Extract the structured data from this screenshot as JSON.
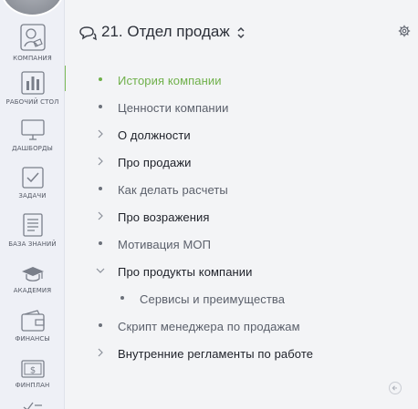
{
  "sidebar": {
    "items": [
      {
        "label": "КОМПАНИЯ",
        "icon": "company-icon"
      },
      {
        "label": "РАБОЧИЙ СТОЛ",
        "icon": "bar-chart-icon"
      },
      {
        "label": "ДАШБОРДЫ",
        "icon": "monitor-icon"
      },
      {
        "label": "ЗАДАЧИ",
        "icon": "checkbox-icon"
      },
      {
        "label": "БАЗА ЗНАНИЙ",
        "icon": "document-icon"
      },
      {
        "label": "АКАДЕМИЯ",
        "icon": "graduation-cap-icon"
      },
      {
        "label": "ФИНАНСЫ",
        "icon": "wallet-icon"
      },
      {
        "label": "ФИНПЛАН",
        "icon": "dollar-bill-icon"
      }
    ]
  },
  "header": {
    "title": "21. Отдел продаж",
    "title_icon": "chat-bubbles-icon",
    "settings_icon": "gear-icon"
  },
  "tree": {
    "items": [
      {
        "label": "История компании",
        "type": "leaf",
        "level": 0,
        "active": true
      },
      {
        "label": "Ценности компании",
        "type": "leaf",
        "level": 0
      },
      {
        "label": "О должности",
        "type": "folder",
        "level": 0,
        "expanded": false
      },
      {
        "label": "Про продажи",
        "type": "folder",
        "level": 0,
        "expanded": false
      },
      {
        "label": "Как делать расчеты",
        "type": "leaf",
        "level": 0
      },
      {
        "label": "Про возражения",
        "type": "folder",
        "level": 0,
        "expanded": false
      },
      {
        "label": "Мотивация МОП",
        "type": "leaf",
        "level": 0
      },
      {
        "label": "Про продукты компании",
        "type": "folder",
        "level": 0,
        "expanded": true
      },
      {
        "label": "Сервисы и преимущества",
        "type": "leaf",
        "level": 1
      },
      {
        "label": "Скрипт менеджера по продажам",
        "type": "leaf",
        "level": 0
      },
      {
        "label": "Внутренние регламенты по работе",
        "type": "folder",
        "level": 0,
        "expanded": false
      }
    ]
  },
  "colors": {
    "accent": "#6fb04a",
    "text_dark": "#1e2129",
    "text_muted": "#5b606b",
    "sidebar_bg": "#eef0f6"
  }
}
